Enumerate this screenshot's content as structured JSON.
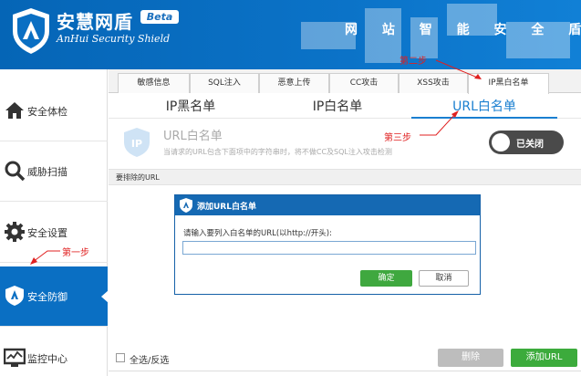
{
  "header": {
    "brand_name": "安慧网盾",
    "beta_badge": "Beta",
    "brand_subtitle": "AnHui Security Shield",
    "slogan": "网 站 智 能 安 全 盾 !"
  },
  "sidebar": {
    "items": [
      {
        "label": "安全体检",
        "icon": "home-icon"
      },
      {
        "label": "威胁扫描",
        "icon": "magnifier-icon"
      },
      {
        "label": "安全设置",
        "icon": "gear-icon"
      },
      {
        "label": "安全防御",
        "icon": "shield-icon",
        "active": true
      },
      {
        "label": "监控中心",
        "icon": "monitor-icon"
      }
    ]
  },
  "tabs": [
    "敏感信息",
    "SQL注入",
    "恶意上传",
    "CC攻击",
    "XSS攻击",
    "IP黑白名单"
  ],
  "active_tab": "IP黑白名单",
  "subtabs": [
    "IP黑名单",
    "IP白名单",
    "URL白名单"
  ],
  "active_subtab": "URL白名单",
  "whitelist": {
    "title": "URL白名单",
    "description": "当请求的URL包含下面项中的字符串时，将不做CC及SQL注入攻击检测",
    "toggle_label": "已关闭",
    "toggle_state": "off"
  },
  "url_list_label": "要排除的URL",
  "bottom": {
    "select_all_label": "全选/反选",
    "delete_button": "删除",
    "add_url_button": "添加URL"
  },
  "dialog": {
    "title": "添加URL白名单",
    "prompt": "请输入要列入白名单的URL(以http://开头):",
    "input_value": "",
    "ok_button": "确定",
    "cancel_button": "取消"
  },
  "annotations": {
    "step1": "第一步",
    "step2": "第二步",
    "step3": "第三步"
  },
  "colors": {
    "brand_blue": "#0a6fc3",
    "active_tab_blue": "#1a7fd0",
    "green_button": "#3cab3c",
    "annotation_red": "#e02020"
  }
}
